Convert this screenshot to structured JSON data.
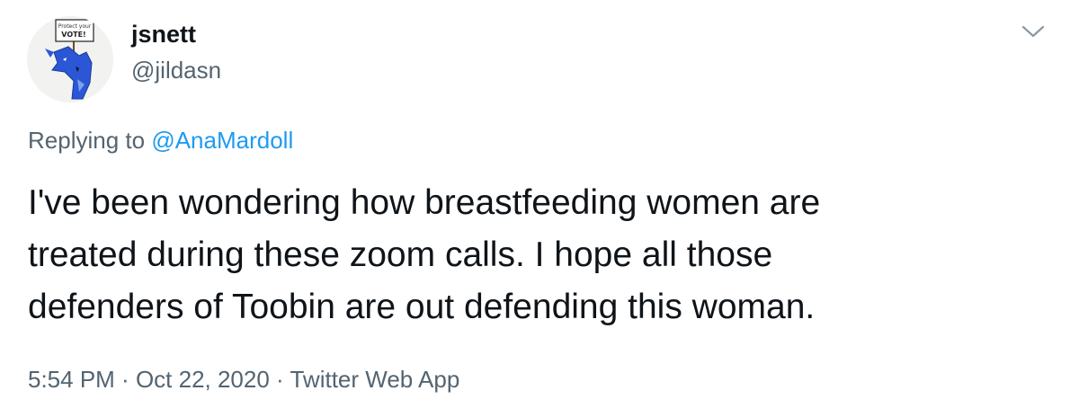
{
  "author": {
    "display_name": "jsnett",
    "handle": "@jildasn",
    "avatar_sign_text": "Protect your VOTE!"
  },
  "reply": {
    "prefix": "Replying to ",
    "mention": "@AnaMardoll"
  },
  "tweet": {
    "lines": [
      "I've been wondering how breastfeeding women are",
      "treated during these zoom calls. I hope all those",
      "defenders of Toobin are out defending this woman."
    ]
  },
  "meta": {
    "time": "5:54 PM",
    "separator": " · ",
    "date": "Oct 22, 2020",
    "source": "Twitter Web App"
  },
  "icons": {
    "more": "chevron-down-icon",
    "avatar": "blue-dragon-vote-sign"
  },
  "colors": {
    "text": "#0f1419",
    "secondary": "#536471",
    "link": "#1d9bf0",
    "avatar_figure": "#2b57d6"
  }
}
